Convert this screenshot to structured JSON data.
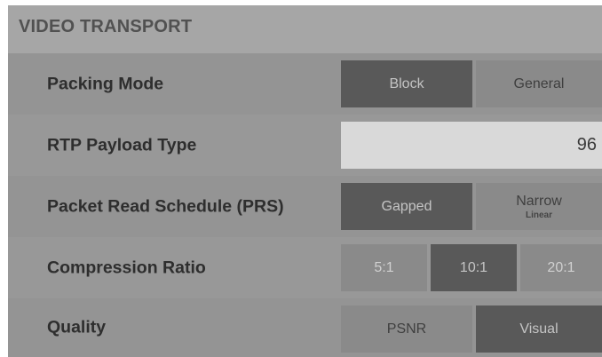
{
  "panel": {
    "title": "VIDEO TRANSPORT"
  },
  "rows": {
    "packing_mode": {
      "label": "Packing Mode",
      "options": [
        "Block",
        "General"
      ],
      "selected": "Block"
    },
    "rtp_payload_type": {
      "label": "RTP Payload Type",
      "value": "96"
    },
    "packet_read_schedule": {
      "label": "Packet Read Schedule (PRS)",
      "options": [
        "Gapped",
        "Narrow"
      ],
      "option_sub": [
        "",
        "Linear"
      ],
      "selected": "Gapped"
    },
    "compression_ratio": {
      "label": "Compression Ratio",
      "options": [
        "5:1",
        "10:1",
        "20:1"
      ],
      "selected": "10:1"
    },
    "quality": {
      "label": "Quality",
      "options": [
        "PSNR",
        "Visual"
      ],
      "selected": "Visual"
    }
  },
  "colors": {
    "panel_background": "#8f8f8f",
    "header_background": "#a6a6a6",
    "selected_segment": "#595959",
    "unselected_segment": "#8a8a8a",
    "input_background": "#d9d9d9",
    "label_text": "#2e2e2e"
  }
}
